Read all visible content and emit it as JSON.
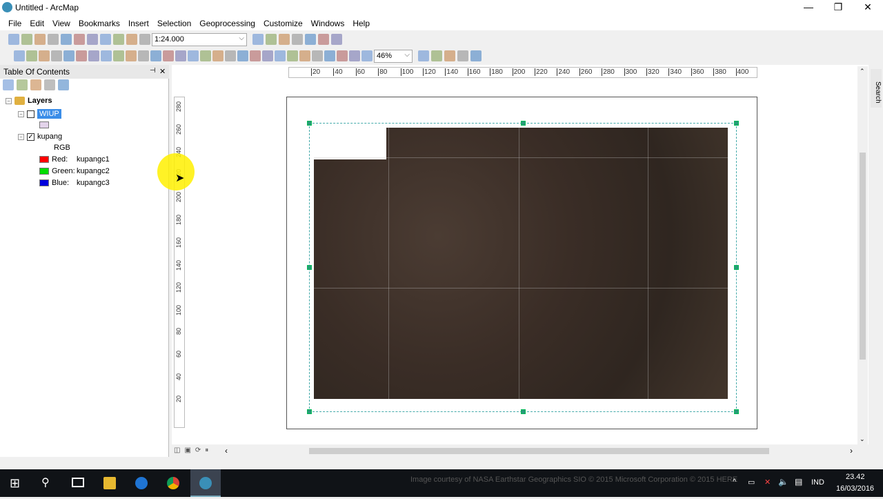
{
  "window": {
    "title": "Untitled - ArcMap",
    "minimize": "—",
    "maximize": "❐",
    "close": "✕"
  },
  "menu": [
    "File",
    "Edit",
    "View",
    "Bookmarks",
    "Insert",
    "Selection",
    "Geoprocessing",
    "Customize",
    "Windows",
    "Help"
  ],
  "toolbar1": {
    "icons": [
      "new-document-icon",
      "open-folder-icon",
      "save-icon",
      "print-icon",
      "cut-icon",
      "copy-icon",
      "paste-icon",
      "delete-icon",
      "undo-icon",
      "redo-icon",
      "add-data-icon"
    ],
    "scale": "1:24.000",
    "icons2": [
      "editor-icon",
      "table-of-contents-icon",
      "catalog-icon",
      "search-window-icon",
      "arctoolbox-icon",
      "python-icon",
      "model-builder-icon"
    ]
  },
  "toolbar2": {
    "icons": [
      "zoom-in-icon",
      "zoom-out-icon",
      "pan-icon",
      "full-extent-icon",
      "fixed-zoom-in-icon",
      "fixed-zoom-out-icon",
      "back-icon",
      "forward-icon",
      "select-features-icon",
      "clear-selection-icon",
      "select-elements-icon",
      "identify-icon",
      "hyperlink-icon",
      "html-popup-icon",
      "measure-icon",
      "find-icon",
      "route-icon",
      "go-to-xy-icon",
      "time-slider-icon",
      "swipe-icon",
      "layout-zoom-in-icon",
      "layout-zoom-out-icon",
      "layout-pan-icon",
      "zoom-whole-page-icon",
      "zoom-100-icon",
      "layout-fixed-zoom-in-icon",
      "layout-fixed-zoom-out-icon",
      "layout-back-icon",
      "layout-forward-icon"
    ],
    "zoom": "46%",
    "icons2": [
      "toggle-draft-mode-icon",
      "focus-data-frame-icon",
      "change-layout-icon",
      "data-driven-pages-icon",
      "lock-icon"
    ]
  },
  "toc": {
    "title": "Table Of Contents",
    "pin": "⊣",
    "close": "✕",
    "icons": [
      "list-by-drawing-order-icon",
      "list-by-source-icon",
      "list-by-visibility-icon",
      "list-by-selection-icon",
      "options-icon"
    ],
    "root": "Layers",
    "layer1": "WIUP",
    "layer2": "kupang",
    "rgb": "RGB",
    "bands": [
      {
        "label": "Red:",
        "value": "kupangc1",
        "color": "#ff0000"
      },
      {
        "label": "Green:",
        "value": "kupangc2",
        "color": "#00dd00"
      },
      {
        "label": "Blue:",
        "value": "kupangc3",
        "color": "#0000dd"
      }
    ]
  },
  "rulers": {
    "h": [
      "20",
      "40",
      "60",
      "80",
      "100",
      "120",
      "140",
      "160",
      "180",
      "200",
      "220",
      "240",
      "260",
      "280",
      "300",
      "320",
      "340",
      "360",
      "380",
      "400"
    ],
    "v": [
      "280",
      "260",
      "240",
      "220",
      "200",
      "180",
      "160",
      "140",
      "120",
      "100",
      "80",
      "60",
      "40",
      "20"
    ]
  },
  "search_tab": "Search",
  "taskbar": {
    "attribution": "Image courtesy of NASA Earthstar Geographics  SIO © 2015 Microsoft Corporation © 2015 HERE",
    "lang": "IND",
    "time": "23.42",
    "date": "16/03/2016"
  }
}
